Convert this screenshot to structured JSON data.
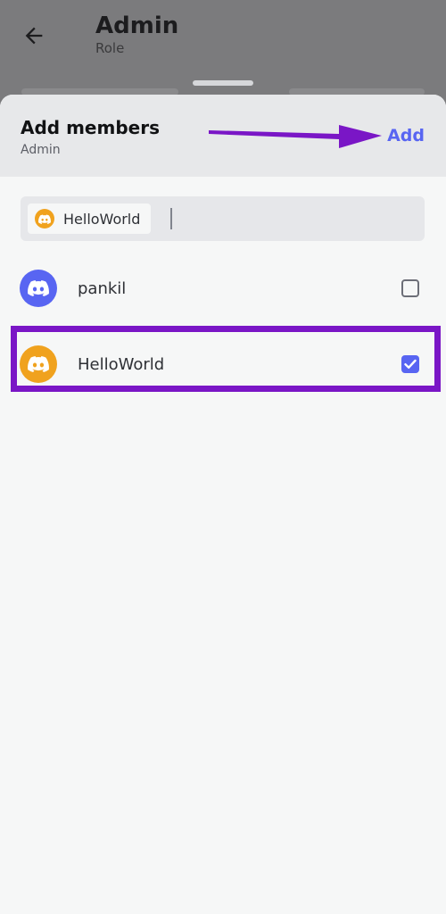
{
  "background": {
    "title": "Admin",
    "subtitle": "Role"
  },
  "sheet": {
    "title": "Add members",
    "subtitle": "Admin",
    "add_label": "Add"
  },
  "search": {
    "chips": [
      {
        "label": "HelloWorld",
        "avatar_color": "#f0a21e",
        "icon": "discord-icon"
      }
    ]
  },
  "members": [
    {
      "name": "pankil",
      "avatar_color": "#5865f2",
      "icon": "discord-icon",
      "checked": false
    },
    {
      "name": "HelloWorld",
      "avatar_color": "#f0a21e",
      "icon": "discord-icon",
      "checked": true
    }
  ],
  "colors": {
    "accent": "#5865f2",
    "annotation": "#7a16c6"
  }
}
